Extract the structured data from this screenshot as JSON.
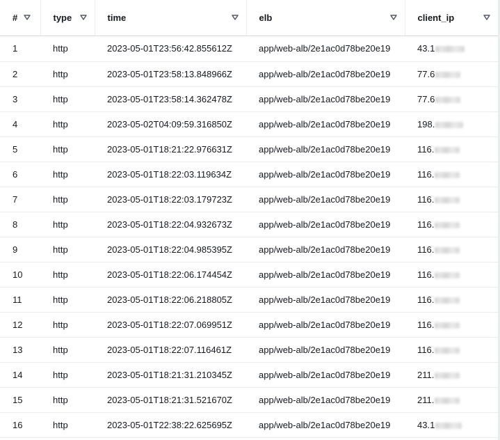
{
  "columns": [
    {
      "label": "#"
    },
    {
      "label": "type"
    },
    {
      "label": "time"
    },
    {
      "label": "elb"
    },
    {
      "label": "client_ip"
    }
  ],
  "rows": [
    {
      "n": "1",
      "type": "http",
      "time": "2023-05-01T23:56:42.855612Z",
      "elb": "app/web-alb/2e1ac0d78be20e19",
      "ip": "43.1"
    },
    {
      "n": "2",
      "type": "http",
      "time": "2023-05-01T23:58:13.848966Z",
      "elb": "app/web-alb/2e1ac0d78be20e19",
      "ip": "77.6"
    },
    {
      "n": "3",
      "type": "http",
      "time": "2023-05-01T23:58:14.362478Z",
      "elb": "app/web-alb/2e1ac0d78be20e19",
      "ip": "77.6"
    },
    {
      "n": "4",
      "type": "http",
      "time": "2023-05-02T04:09:59.316850Z",
      "elb": "app/web-alb/2e1ac0d78be20e19",
      "ip": "198."
    },
    {
      "n": "5",
      "type": "http",
      "time": "2023-05-01T18:21:22.976631Z",
      "elb": "app/web-alb/2e1ac0d78be20e19",
      "ip": "116."
    },
    {
      "n": "6",
      "type": "http",
      "time": "2023-05-01T18:22:03.119634Z",
      "elb": "app/web-alb/2e1ac0d78be20e19",
      "ip": "116."
    },
    {
      "n": "7",
      "type": "http",
      "time": "2023-05-01T18:22:03.179723Z",
      "elb": "app/web-alb/2e1ac0d78be20e19",
      "ip": "116."
    },
    {
      "n": "8",
      "type": "http",
      "time": "2023-05-01T18:22:04.932673Z",
      "elb": "app/web-alb/2e1ac0d78be20e19",
      "ip": "116."
    },
    {
      "n": "9",
      "type": "http",
      "time": "2023-05-01T18:22:04.985395Z",
      "elb": "app/web-alb/2e1ac0d78be20e19",
      "ip": "116."
    },
    {
      "n": "10",
      "type": "http",
      "time": "2023-05-01T18:22:06.174454Z",
      "elb": "app/web-alb/2e1ac0d78be20e19",
      "ip": "116."
    },
    {
      "n": "11",
      "type": "http",
      "time": "2023-05-01T18:22:06.218805Z",
      "elb": "app/web-alb/2e1ac0d78be20e19",
      "ip": "116."
    },
    {
      "n": "12",
      "type": "http",
      "time": "2023-05-01T18:22:07.069951Z",
      "elb": "app/web-alb/2e1ac0d78be20e19",
      "ip": "116."
    },
    {
      "n": "13",
      "type": "http",
      "time": "2023-05-01T18:22:07.116461Z",
      "elb": "app/web-alb/2e1ac0d78be20e19",
      "ip": "116."
    },
    {
      "n": "14",
      "type": "http",
      "time": "2023-05-01T18:21:31.210345Z",
      "elb": "app/web-alb/2e1ac0d78be20e19",
      "ip": "211."
    },
    {
      "n": "15",
      "type": "http",
      "time": "2023-05-01T18:21:31.521670Z",
      "elb": "app/web-alb/2e1ac0d78be20e19",
      "ip": "211."
    },
    {
      "n": "16",
      "type": "http",
      "time": "2023-05-01T22:38:22.625695Z",
      "elb": "app/web-alb/2e1ac0d78be20e19",
      "ip": "43.1"
    }
  ],
  "icons": {
    "sort": "sort-triangle-down-icon"
  },
  "colors": {
    "text": "#16191f",
    "border": "#eaeded",
    "header_border": "#d5dbdb"
  }
}
